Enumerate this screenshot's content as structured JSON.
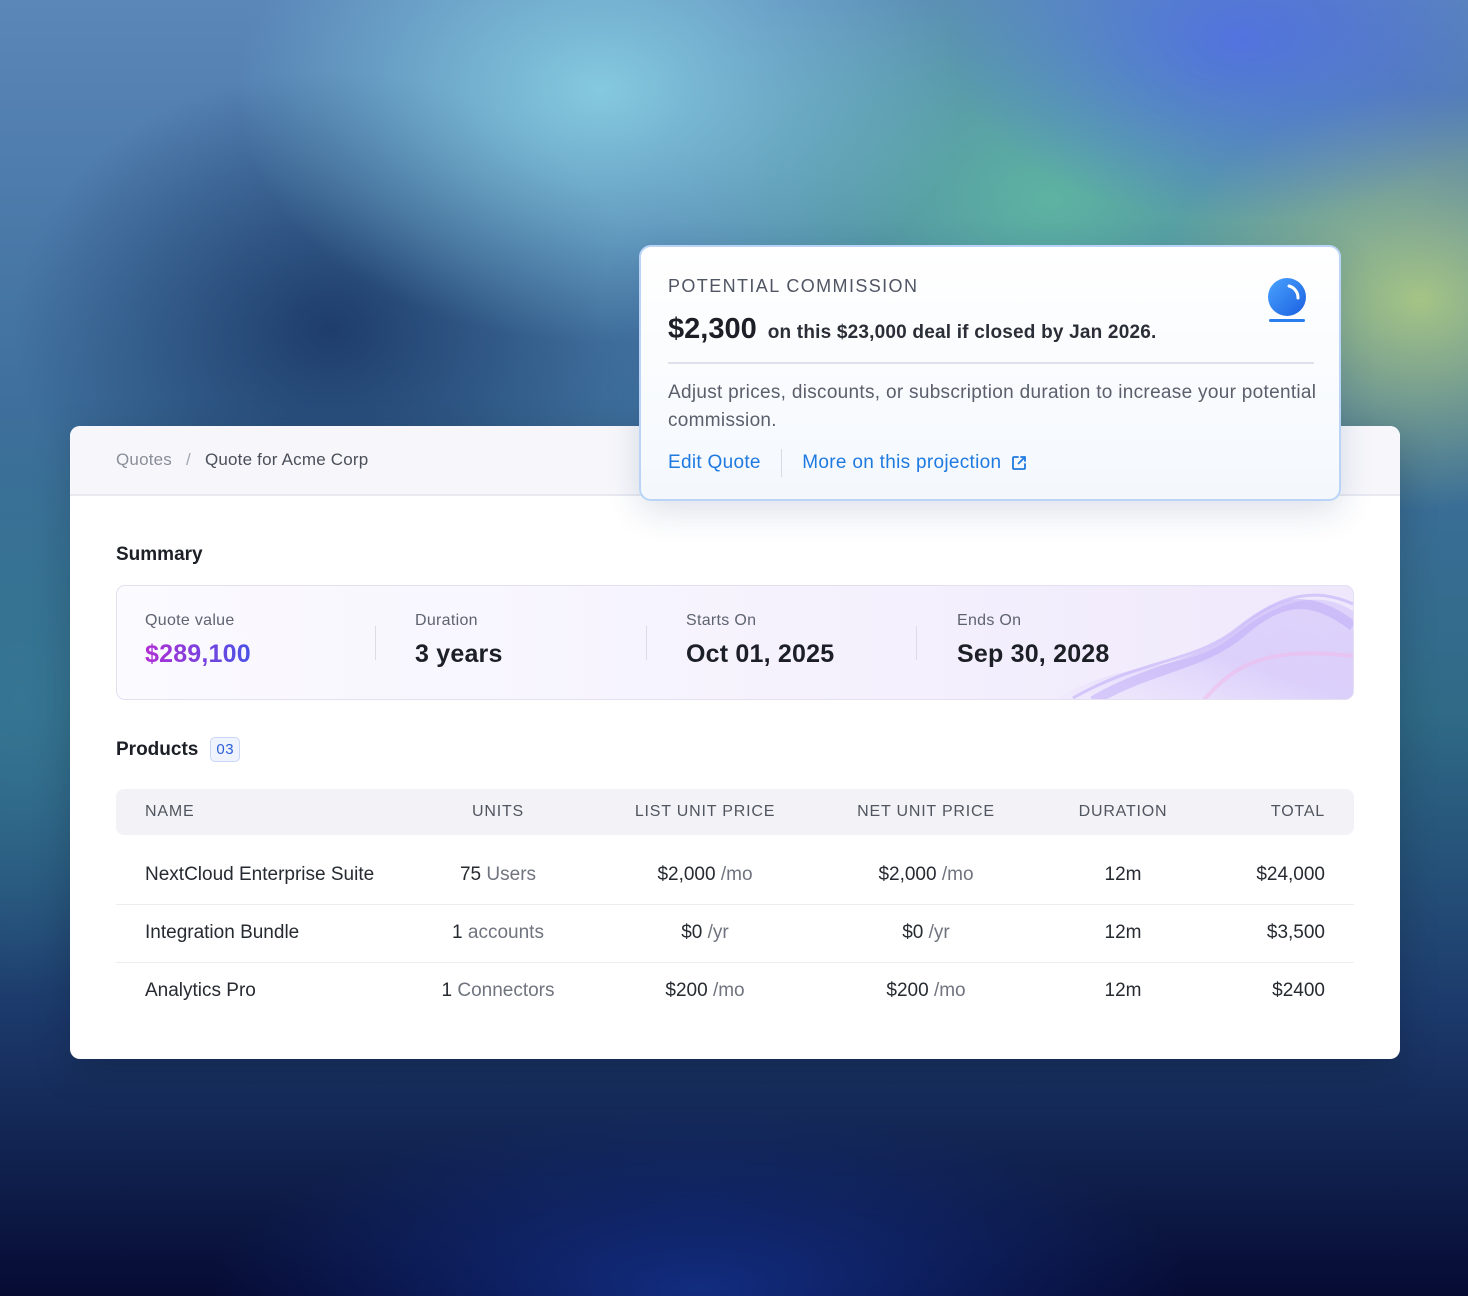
{
  "commission": {
    "label": "POTENTIAL COMMISSION",
    "amount": "$2,300",
    "detail": "on this $23,000 deal if closed by Jan 2026.",
    "body": "Adjust prices, discounts, or subscription duration to increase your potential commission.",
    "edit_link": "Edit Quote",
    "more_link": "More on this projection",
    "icon": "crystal-ball-icon"
  },
  "breadcrumb": {
    "root": "Quotes",
    "separator": "/",
    "current": "Quote for Acme Corp"
  },
  "summary": {
    "title": "Summary",
    "stats": [
      {
        "label": "Quote value",
        "value": "$289,100"
      },
      {
        "label": "Duration",
        "value": "3 years"
      },
      {
        "label": "Starts On",
        "value": "Oct 01, 2025"
      },
      {
        "label": "Ends On",
        "value": "Sep 30, 2028"
      }
    ]
  },
  "products": {
    "title": "Products",
    "count": "03",
    "columns": [
      "NAME",
      "UNITS",
      "LIST UNIT PRICE",
      "NET UNIT PRICE",
      "DURATION",
      "TOTAL"
    ],
    "rows": [
      {
        "name": "NextCloud Enterprise Suite",
        "units_num": "75",
        "units_unit": "Users",
        "list_price": "$2,000",
        "list_period": "/mo",
        "net_price": "$2,000",
        "net_period": "/mo",
        "duration": "12m",
        "total": "$24,000"
      },
      {
        "name": "Integration Bundle",
        "units_num": "1",
        "units_unit": "accounts",
        "list_price": "$0",
        "list_period": "/yr",
        "net_price": "$0",
        "net_period": "/yr",
        "duration": "12m",
        "total": "$3,500"
      },
      {
        "name": "Analytics Pro",
        "units_num": "1",
        "units_unit": "Connectors",
        "list_price": "$200",
        "list_period": "/mo",
        "net_price": "$200",
        "net_period": "/mo",
        "duration": "12m",
        "total": "$2400"
      }
    ]
  },
  "colors": {
    "accent_link": "#1f7ae0",
    "quote_value_gradient_start": "#b02fd4",
    "quote_value_gradient_end": "#4a52e6"
  }
}
